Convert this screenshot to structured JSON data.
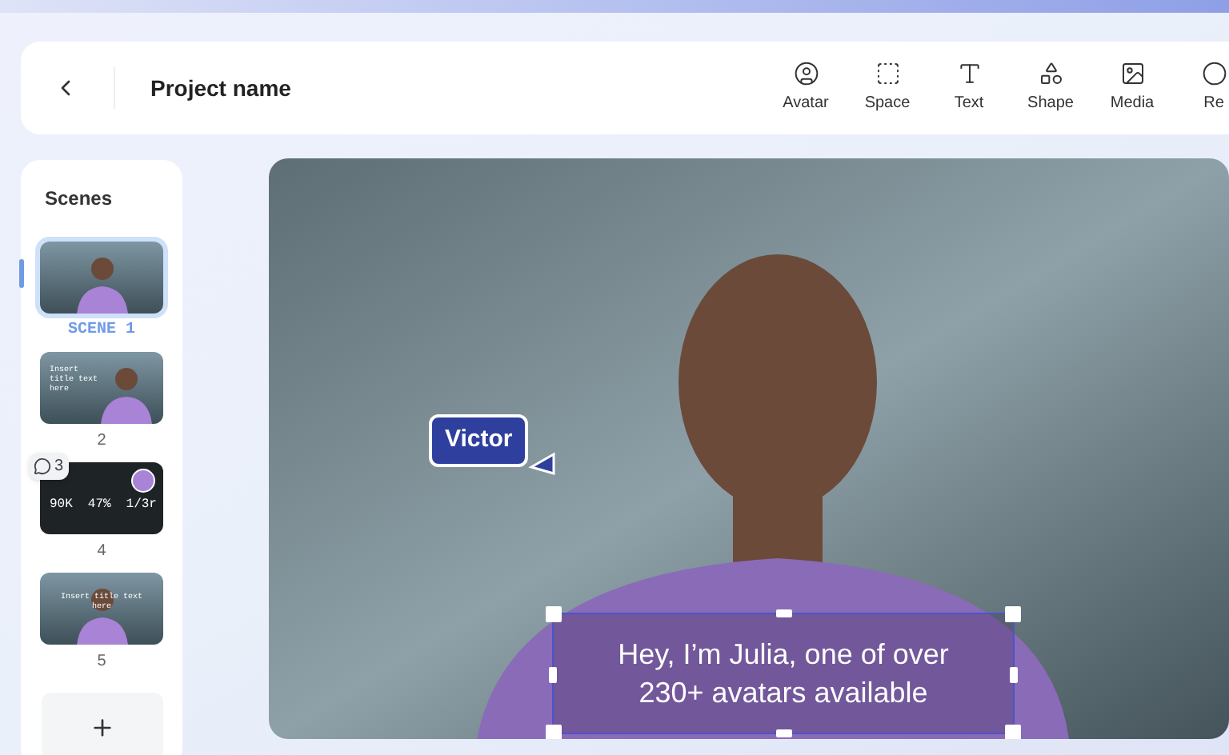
{
  "header": {
    "project_name": "Project name",
    "tools": [
      {
        "label": "Avatar"
      },
      {
        "label": "Space"
      },
      {
        "label": "Text"
      },
      {
        "label": "Shape"
      },
      {
        "label": "Media"
      },
      {
        "label": "Re"
      }
    ]
  },
  "scenes": {
    "title": "Scenes",
    "items": [
      {
        "kind": "avatar",
        "label": "SCENE 1",
        "selected": true
      },
      {
        "kind": "title",
        "label": "2",
        "selected": false,
        "title": "Insert title text here"
      },
      {
        "kind": "stats",
        "label": "4",
        "selected": false,
        "stats": [
          "90K",
          "47%",
          "1/3r"
        ],
        "comments": "3"
      },
      {
        "kind": "centered",
        "label": "5",
        "selected": false,
        "title": "Insert title text here"
      }
    ]
  },
  "canvas": {
    "collaborator": {
      "name": "Victor",
      "color": "#2f3f9e"
    },
    "caption_lines": [
      "Hey, I’m Julia, one of over",
      "230+ avatars available"
    ]
  }
}
